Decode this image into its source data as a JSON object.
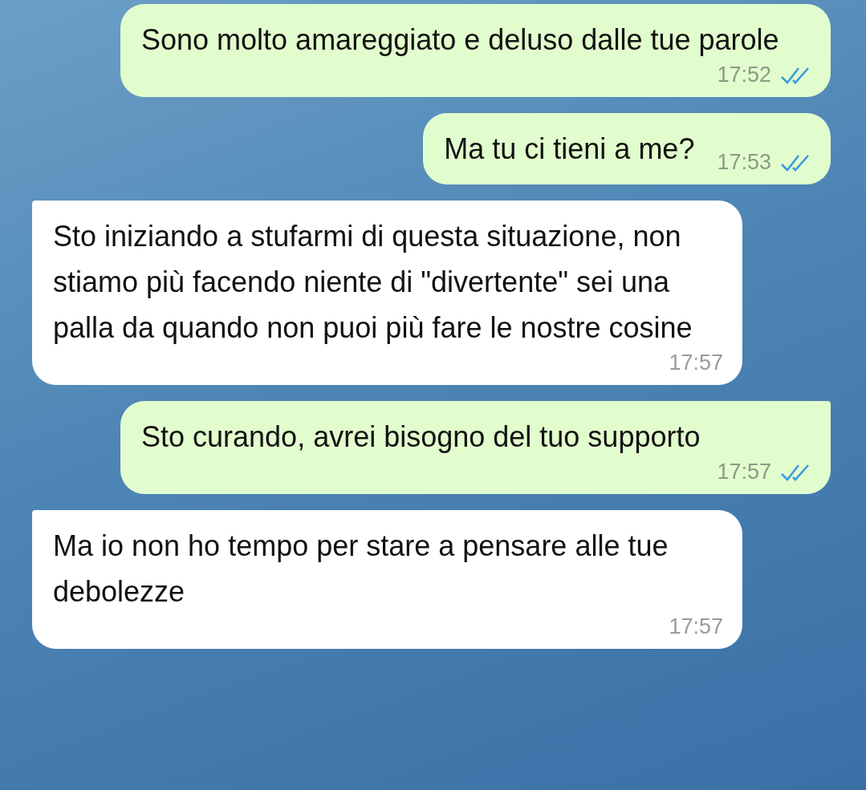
{
  "messages": [
    {
      "kind": "outgoing",
      "text": "Sono molto amareggiato e deluso dalle tue parole",
      "time": "17:52",
      "read": true,
      "tail": false
    },
    {
      "kind": "outgoing",
      "text": "Ma tu ci tieni a me?",
      "time": "17:53",
      "read": true,
      "tail": false
    },
    {
      "kind": "incoming",
      "text": "Sto iniziando a stufarmi di questa situazione, non stiamo più facendo niente di \"divertente\" sei una palla da quando non puoi più fare le nostre cosine",
      "time": "17:57",
      "tail": true
    },
    {
      "kind": "outgoing",
      "text": "Sto curando, avrei bisogno del tuo supporto",
      "time": "17:57",
      "read": true,
      "tail": true
    },
    {
      "kind": "incoming",
      "text": "Ma io non ho tempo per stare a pensare alle tue debolezze",
      "time": "17:57",
      "tail": true
    }
  ]
}
